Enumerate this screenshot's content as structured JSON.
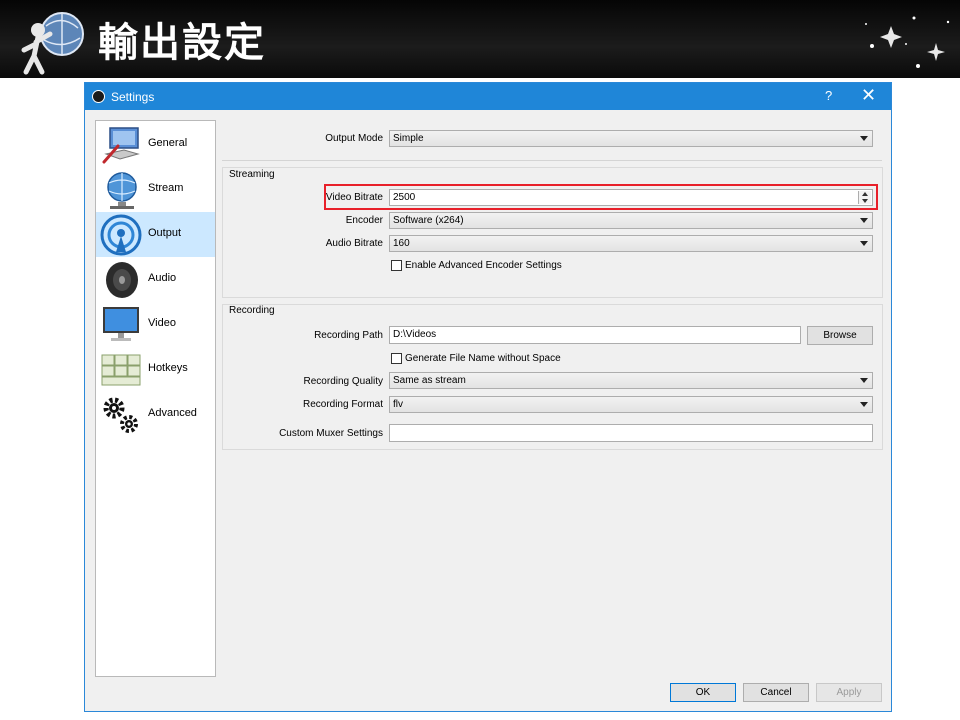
{
  "slide": {
    "title": "輸出設定"
  },
  "window": {
    "title": "Settings",
    "help": "?",
    "close": "✕"
  },
  "sidebar": {
    "items": [
      {
        "label": "General",
        "icon": "computer-icon",
        "active": false
      },
      {
        "label": "Stream",
        "icon": "globe-icon",
        "active": false
      },
      {
        "label": "Output",
        "icon": "broadcast-icon",
        "active": true
      },
      {
        "label": "Audio",
        "icon": "speaker-icon",
        "active": false
      },
      {
        "label": "Video",
        "icon": "monitor-icon",
        "active": false
      },
      {
        "label": "Hotkeys",
        "icon": "keyboard-icon",
        "active": false
      },
      {
        "label": "Advanced",
        "icon": "gears-icon",
        "active": false
      }
    ]
  },
  "output_mode": {
    "label": "Output Mode",
    "value": "Simple"
  },
  "streaming": {
    "title": "Streaming",
    "video_bitrate": {
      "label": "Video Bitrate",
      "value": "2500"
    },
    "encoder": {
      "label": "Encoder",
      "value": "Software (x264)"
    },
    "audio_bitrate": {
      "label": "Audio Bitrate",
      "value": "160"
    },
    "advanced_encoder": {
      "label": "Enable Advanced Encoder Settings",
      "checked": false
    }
  },
  "recording": {
    "title": "Recording",
    "path": {
      "label": "Recording Path",
      "value": "D:\\Videos"
    },
    "browse": "Browse",
    "no_space": {
      "label": "Generate File Name without Space",
      "checked": false
    },
    "quality": {
      "label": "Recording Quality",
      "value": "Same as stream"
    },
    "format": {
      "label": "Recording Format",
      "value": "flv"
    },
    "muxer": {
      "label": "Custom Muxer Settings",
      "value": ""
    }
  },
  "footer": {
    "ok": "OK",
    "cancel": "Cancel",
    "apply": "Apply"
  },
  "colors": {
    "titlebar": "#1f86d8",
    "selection": "#cce8ff",
    "highlight": "#e8202a"
  }
}
